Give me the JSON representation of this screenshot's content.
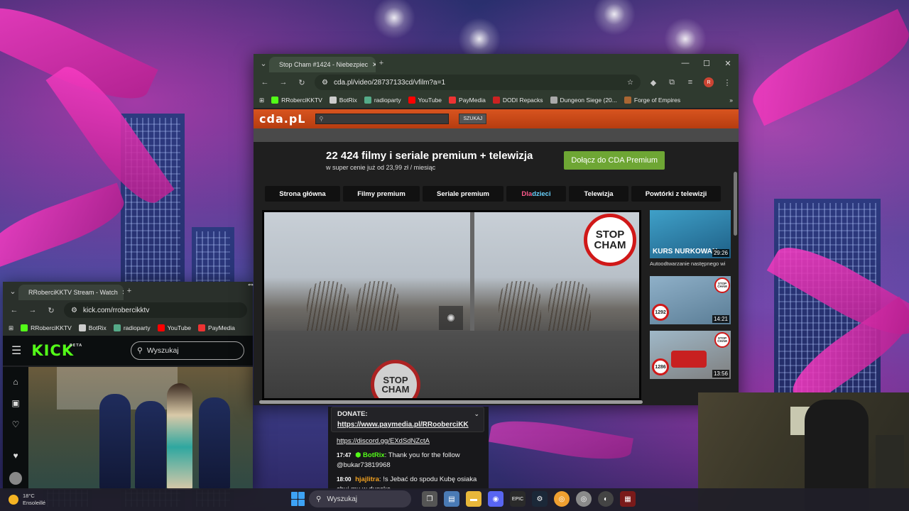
{
  "desktop": {
    "taskbar": {
      "weather_temp": "18°C",
      "weather_desc": "Ensoleillé",
      "search_placeholder": "Wyszukaj"
    }
  },
  "cda_window": {
    "tab_title": "Stop Cham #1424 - Niebezpiec",
    "url": "cda.pl/video/28737133cd/vfilm?a=1",
    "bookmarks": [
      "RRoberciKKTV",
      "BotRix",
      "radioparty",
      "YouTube",
      "PayMedia",
      "DODI Repacks",
      "Dungeon Siege (20...",
      "Forge of Empires"
    ],
    "page": {
      "logo": "cda.pL",
      "search_button": "SZUKAJ",
      "promo_title": "22 424 filmy i seriale premium + telewizja",
      "promo_subtitle": "w super cenie już od 23,99 zł / miesiąc",
      "join_button": "Dołącz do CDA Premium",
      "menu": [
        "Strona główna",
        "Filmy premium",
        "Seriale premium",
        "Dla dzieci",
        "Telewizja",
        "Powtórki z telewizji"
      ],
      "menu_kids_prefix": "Dla ",
      "menu_kids_suffix": "dzieci",
      "video_sign_line1": "STOP",
      "video_sign_line2": "CHAM",
      "autoplay_text": "Autoodtwarzanie następnego wi",
      "thumbnails": [
        {
          "duration": "29:26",
          "overlay": "KURS NURKOWAN",
          "badge": ""
        },
        {
          "duration": "14:21",
          "overlay": "",
          "badge": "1292"
        },
        {
          "duration": "13:56",
          "overlay": "",
          "badge": "1286"
        }
      ]
    }
  },
  "kick_window": {
    "tab_title": "RRoberciKKTV Stream - Watch",
    "url": "kick.com/rrobercikktv",
    "bookmarks": [
      "RRoberciKKTV",
      "BotRix",
      "radioparty",
      "YouTube",
      "PayMedia"
    ],
    "logo": "KICK",
    "logo_badge": "BETA",
    "search_placeholder": "Wyszukaj"
  },
  "chat": {
    "donate_label": "DONATE:",
    "donate_url": "https://www.paymedia.pl/RRooberciKK",
    "discord_url": "https://discord.gg/EXdSdNZctA",
    "messages": [
      {
        "time": "17:47",
        "user": "BotRix",
        "user_color": "#53fc18",
        "text": "Thank you for the follow @bukar73819968"
      },
      {
        "time": "18:00",
        "user": "hjajlitra",
        "user_color": "#f0a020",
        "text": "!s Jebać do spodu Kubę osiaka chuj mu w dupske"
      }
    ]
  }
}
